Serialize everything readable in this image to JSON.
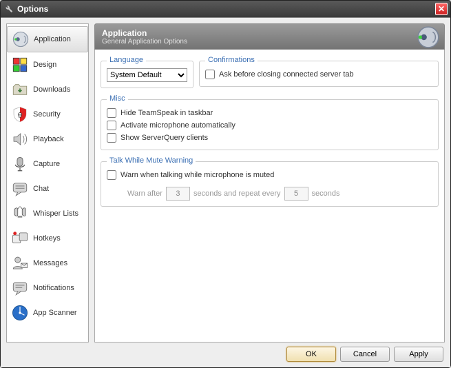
{
  "window": {
    "title": "Options"
  },
  "sidebar": {
    "items": [
      {
        "label": "Application",
        "selected": true,
        "icon": "application-icon"
      },
      {
        "label": "Design",
        "selected": false,
        "icon": "design-icon"
      },
      {
        "label": "Downloads",
        "selected": false,
        "icon": "downloads-icon"
      },
      {
        "label": "Security",
        "selected": false,
        "icon": "security-icon"
      },
      {
        "label": "Playback",
        "selected": false,
        "icon": "playback-icon"
      },
      {
        "label": "Capture",
        "selected": false,
        "icon": "capture-icon"
      },
      {
        "label": "Chat",
        "selected": false,
        "icon": "chat-icon"
      },
      {
        "label": "Whisper Lists",
        "selected": false,
        "icon": "whisper-lists-icon"
      },
      {
        "label": "Hotkeys",
        "selected": false,
        "icon": "hotkeys-icon"
      },
      {
        "label": "Messages",
        "selected": false,
        "icon": "messages-icon"
      },
      {
        "label": "Notifications",
        "selected": false,
        "icon": "notifications-icon"
      },
      {
        "label": "App Scanner",
        "selected": false,
        "icon": "app-scanner-icon"
      }
    ]
  },
  "header": {
    "title": "Application",
    "subtitle": "General Application Options"
  },
  "language": {
    "group_label": "Language",
    "selected": "System Default"
  },
  "confirmations": {
    "group_label": "Confirmations",
    "option1": "Ask before closing connected server tab"
  },
  "misc": {
    "group_label": "Misc",
    "option1": "Hide TeamSpeak in taskbar",
    "option2": "Activate microphone automatically",
    "option3": "Show ServerQuery clients"
  },
  "talk_warning": {
    "group_label": "Talk While Mute Warning",
    "option1": "Warn when talking while microphone is muted",
    "warn_after_label": "Warn after",
    "warn_after_value": "3",
    "repeat_label": "seconds and repeat every",
    "repeat_value": "5",
    "seconds_label": "seconds"
  },
  "buttons": {
    "ok": "OK",
    "cancel": "Cancel",
    "apply": "Apply"
  }
}
